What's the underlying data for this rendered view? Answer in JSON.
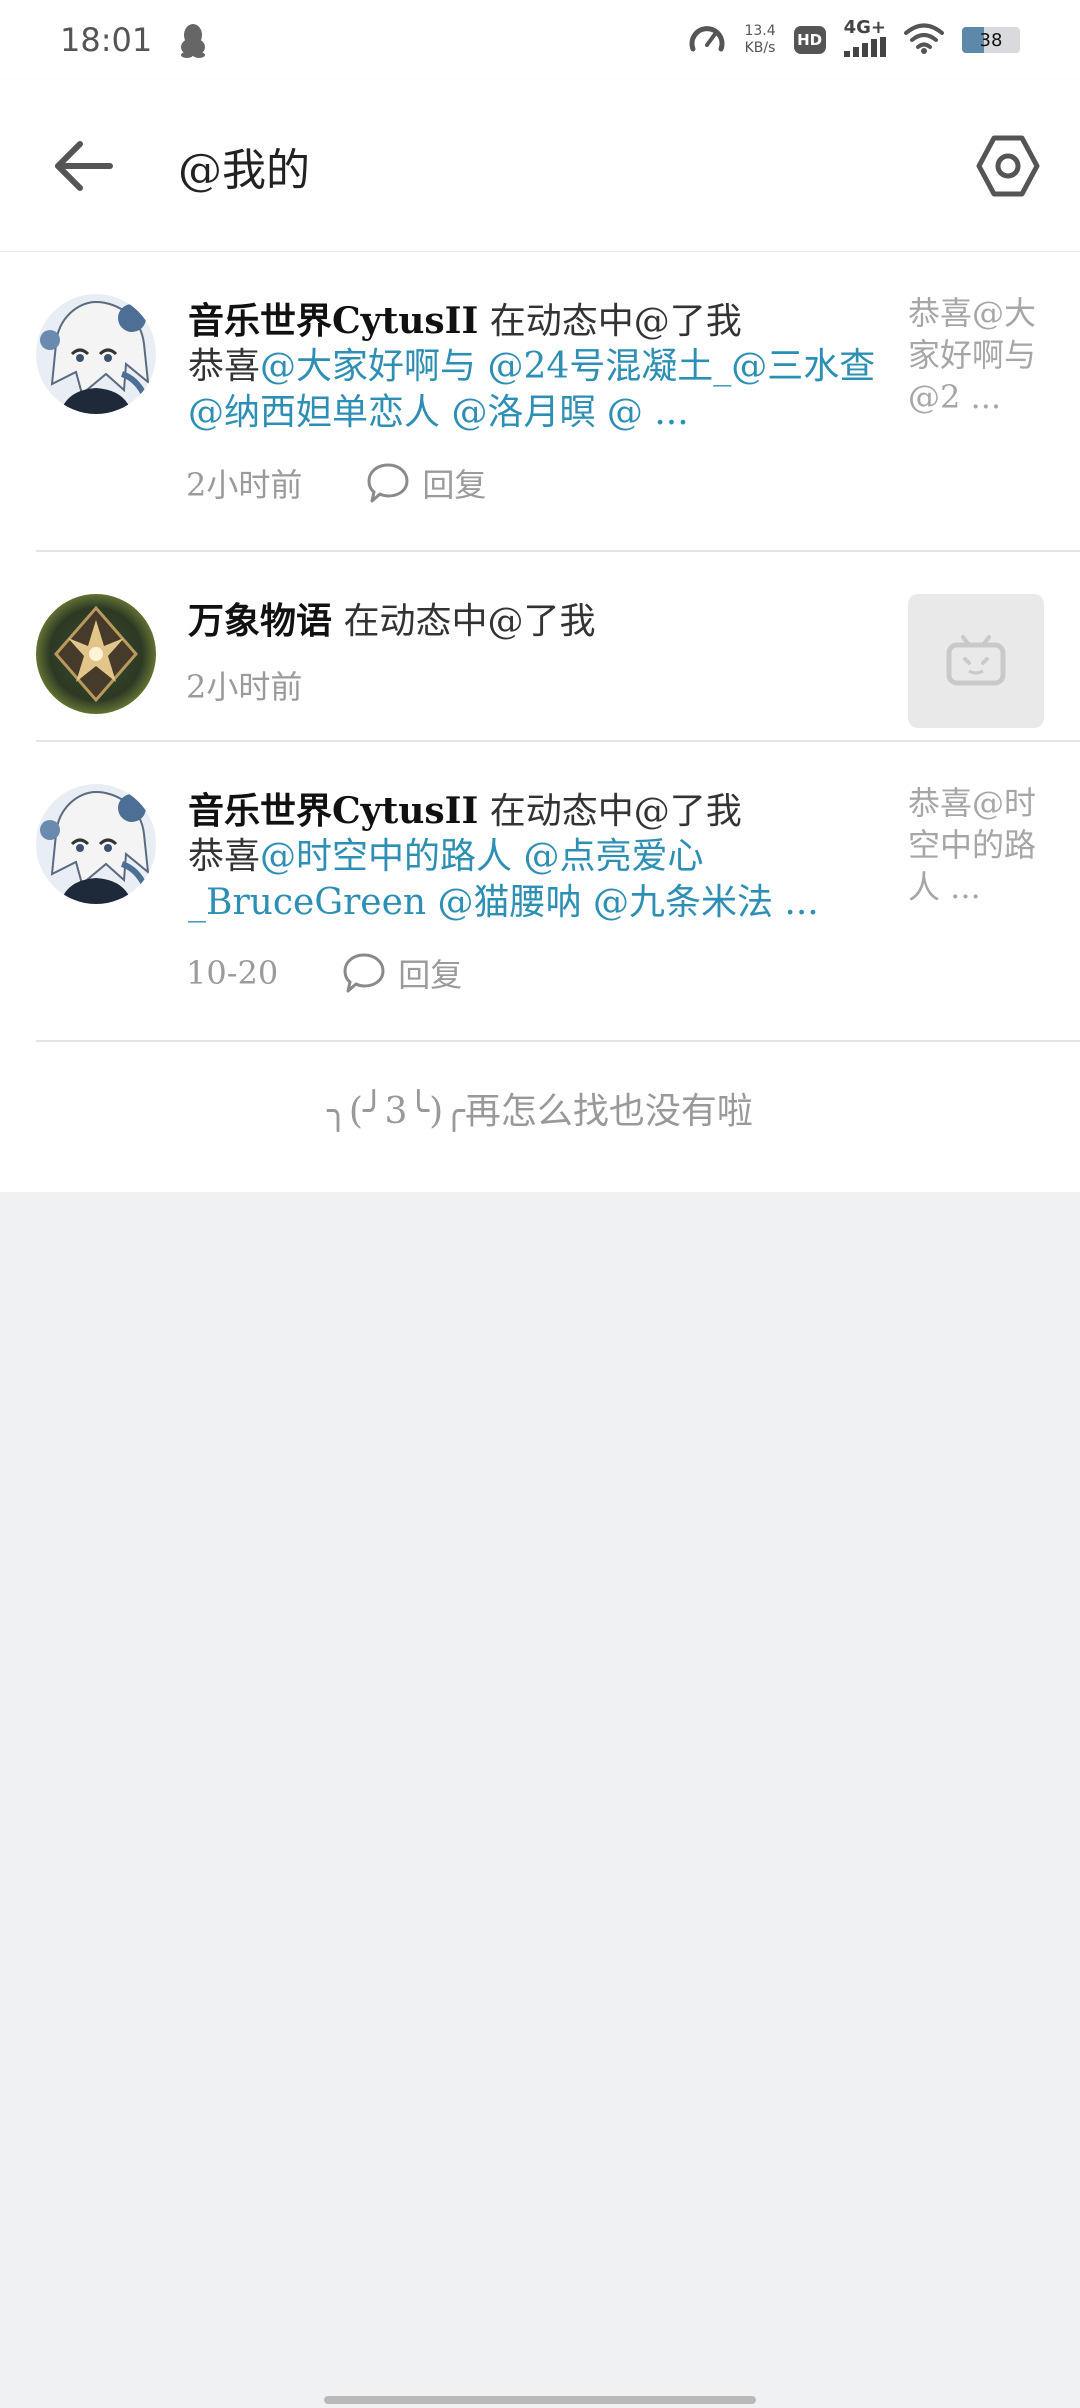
{
  "status_bar": {
    "time": "18:01",
    "net_speed_value": "13.4",
    "net_speed_unit": "KB/s",
    "hd_label": "HD",
    "network_label": "4G+",
    "battery_level": "38",
    "battery_fraction": 0.38,
    "icons": [
      "qq-penguin-icon",
      "speedometer-icon",
      "hd-icon",
      "signal-icon",
      "wifi-icon",
      "battery-icon"
    ]
  },
  "header": {
    "title": "@我的",
    "back_icon": "arrow-left-icon",
    "settings_icon": "hexagon-gear-icon"
  },
  "notifications": [
    {
      "user": "音乐世界CytusII",
      "action": " 在动态中@了我",
      "body_prefix": "恭喜",
      "body_mentions": "@大家好啊与 @24号混凝土_@三水查 @纳西妲单恋人 @洛月暝 @ ...",
      "time": "2小时前",
      "reply_label": "回复",
      "preview": "恭喜@大家好啊与 @2 ..."
    },
    {
      "user": "万象物语",
      "action": " 在动态中@了我",
      "time": "2小时前",
      "preview_icon": "bilibili-tv-icon"
    },
    {
      "user": "音乐世界CytusII",
      "action": " 在动态中@了我",
      "body_prefix": "恭喜",
      "body_mentions": "@时空中的路人 @点亮爱心_BruceGreen @猫腰呐 @九条米法 ...",
      "time": "10-20",
      "reply_label": "回复",
      "preview": "恭喜@时空中的路人 ..."
    }
  ],
  "end_message": "╮(╯3╰)╭再怎么找也没有啦",
  "colors": {
    "mention": "#2d8fb3",
    "background": "#f0f1f3",
    "muted_text": "#9b9b9b"
  }
}
